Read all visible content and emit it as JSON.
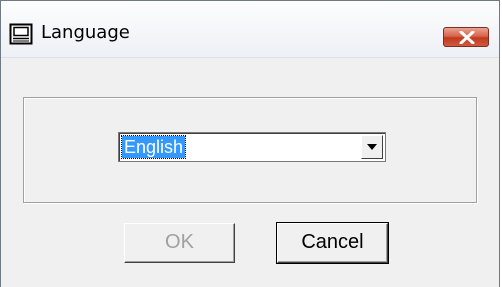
{
  "window": {
    "title": "Language",
    "close_icon": "close-icon",
    "app_icon": "monitor-icon"
  },
  "language_select": {
    "value": "English"
  },
  "buttons": {
    "ok_label": "OK",
    "ok_enabled": false,
    "cancel_label": "Cancel"
  },
  "colors": {
    "selection": "#3399ff",
    "close_button": "#c7452a"
  }
}
